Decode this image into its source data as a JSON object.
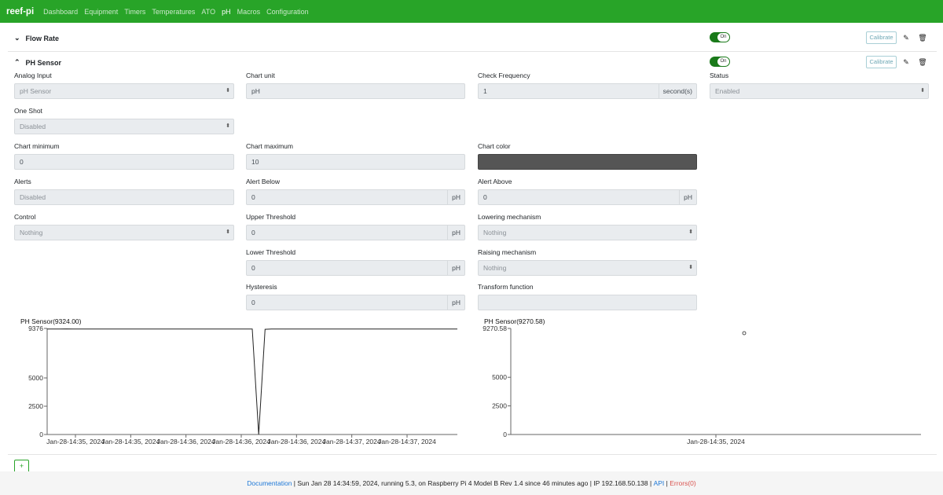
{
  "navbar": {
    "brand": "reef-pi",
    "links": [
      "Dashboard",
      "Equipment",
      "Timers",
      "Temperatures",
      "ATO",
      "pH",
      "Macros",
      "Configuration"
    ],
    "active": "pH"
  },
  "sections": [
    {
      "title": "Flow Rate",
      "toggle": "On",
      "calibrate": "Calibrate"
    },
    {
      "title": "PH Sensor",
      "toggle": "On",
      "calibrate": "Calibrate"
    }
  ],
  "form": {
    "analog_input": {
      "label": "Analog Input",
      "value": "pH Sensor"
    },
    "chart_unit": {
      "label": "Chart unit",
      "value": "pH"
    },
    "check_frequency": {
      "label": "Check Frequency",
      "value": "1",
      "unit": "second(s)"
    },
    "status": {
      "label": "Status",
      "value": "Enabled"
    },
    "one_shot": {
      "label": "One Shot",
      "value": "Disabled"
    },
    "chart_minimum": {
      "label": "Chart minimum",
      "value": "0"
    },
    "chart_maximum": {
      "label": "Chart maximum",
      "value": "10"
    },
    "chart_color": {
      "label": "Chart color",
      "value": "#555555"
    },
    "alerts": {
      "label": "Alerts",
      "value": "Disabled"
    },
    "alert_below": {
      "label": "Alert Below",
      "value": "0",
      "unit": "pH"
    },
    "alert_above": {
      "label": "Alert Above",
      "value": "0",
      "unit": "pH"
    },
    "control": {
      "label": "Control",
      "value": "Nothing"
    },
    "upper_threshold": {
      "label": "Upper Threshold",
      "value": "0",
      "unit": "pH"
    },
    "lowering_mechanism": {
      "label": "Lowering mechanism",
      "value": "Nothing"
    },
    "lower_threshold": {
      "label": "Lower Threshold",
      "value": "0",
      "unit": "pH"
    },
    "raising_mechanism": {
      "label": "Raising mechanism",
      "value": "Nothing"
    },
    "hysteresis": {
      "label": "Hysteresis",
      "value": "0",
      "unit": "pH"
    },
    "transform_function": {
      "label": "Transform function",
      "value": ""
    }
  },
  "chart_data": [
    {
      "type": "line",
      "title": "PH Sensor(9324.00)",
      "yticks": [
        "0",
        "2500",
        "5000",
        "9376"
      ],
      "ylim": [
        0,
        9376
      ],
      "xticks": [
        "Jan-28-14:35, 2024",
        "Jan-28-14:35, 2024",
        "Jan-28-14:36, 2024",
        "Jan-28-14:36, 2024",
        "Jan-28-14:36, 2024",
        "Jan-28-14:37, 2024",
        "Jan-28-14:37, 2024"
      ],
      "series": [
        {
          "values": [
            9320,
            9330,
            9325,
            9335,
            9320,
            9328,
            9322,
            9330,
            9326,
            9324,
            9318,
            9330,
            9325,
            9320,
            9328,
            9330,
            9322,
            9326,
            9330,
            9324,
            9328,
            9320,
            9326,
            9330,
            9325,
            9320,
            9328,
            9324,
            9330,
            9322,
            9326,
            9328,
            9324,
            0,
            9300,
            9330,
            9325,
            9320,
            9328,
            9330,
            9322,
            9326,
            9330,
            9324,
            9328,
            9320,
            9326,
            9330,
            9325,
            9320,
            9328,
            9324,
            9330,
            9322,
            9326,
            9328,
            9324,
            9326,
            9330,
            9324,
            9320,
            9328,
            9325,
            9330,
            9324
          ]
        }
      ]
    },
    {
      "type": "scatter",
      "title": "PH Sensor(9270.58)",
      "yticks": [
        "0",
        "2500",
        "5000",
        "9270.58"
      ],
      "ylim": [
        0,
        9270.58
      ],
      "xticks": [
        "Jan-28-14:35, 2024"
      ],
      "series": [
        {
          "values": [
            9270.58
          ]
        }
      ]
    }
  ],
  "footer": {
    "documentation": "Documentation",
    "status": "Sun Jan 28 14:34:59, 2024,  running 5.3, on Raspberry Pi 4 Model B Rev 1.4  since 46 minutes ago",
    "ip": "IP 192.168.50.138",
    "api": "API",
    "errors": "Errors(0)"
  },
  "add_button": "+"
}
